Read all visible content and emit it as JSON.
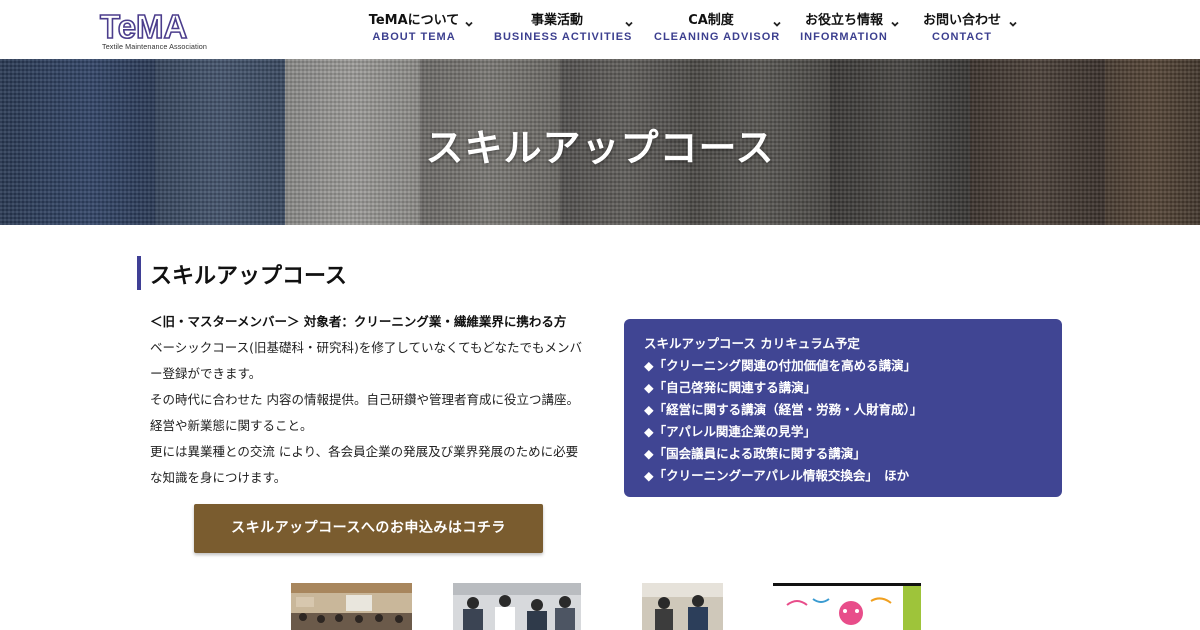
{
  "header": {
    "logo_text": "TeMA",
    "logo_sub": "Textile Maintenance Association",
    "nav": [
      {
        "jp": "TeMAについて",
        "en": "ABOUT TEMA"
      },
      {
        "jp": "事業活動",
        "en": "BUSINESS ACTIVITIES"
      },
      {
        "jp": "CA制度",
        "en": "CLEANING ADVISOR"
      },
      {
        "jp": "お役立ち情報",
        "en": "INFORMATION"
      },
      {
        "jp": "お問い合わせ",
        "en": "CONTACT"
      }
    ]
  },
  "hero": {
    "title": "スキルアップコース"
  },
  "section": {
    "title": "スキルアップコース",
    "lead": "＜旧・マスターメンバー＞ 対象者：クリーニング業・繊維業界に携わる方",
    "lines": [
      "ベーシックコース(旧基礎科・研究科)を修了していなくてもどなたでもメンバ",
      "ー登録ができます。",
      "その時代に合わせた 内容の情報提供。自己研鑽や管理者育成に役立つ講座。",
      "経営や新業態に関すること。",
      "更には異業種との交流 により、各会員企業の発展及び業界発展のために必要",
      "な知識を身につけます。"
    ],
    "apply_button": "スキルアップコースへのお申込みはコチラ"
  },
  "curriculum": {
    "title": "スキルアップコース カリキュラム予定",
    "items": [
      "◆「クリーニング関連の付加価値を高める講演」",
      "◆「自己啓発に関連する講演」",
      "◆「経営に関する講演（経営・労務・人財育成）」",
      "◆「アパレル関連企業の見学」",
      "◆「国会議員による政策に関する講演」",
      "◆「クリーニングーアパレル情報交換会」　ほか"
    ]
  },
  "colors": {
    "accent": "#3f3f95",
    "nav_en": "#3c3f8f",
    "curriculum_bg": "#404593",
    "button_bg": "#7a5c2f"
  }
}
